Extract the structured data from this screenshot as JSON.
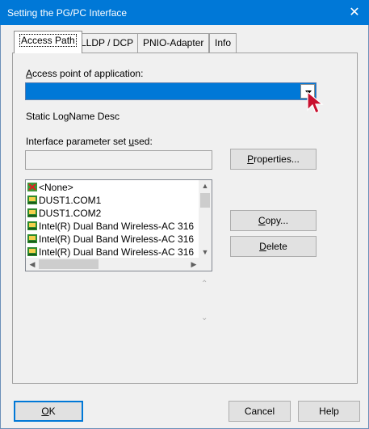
{
  "window": {
    "title": "Setting the PG/PC Interface",
    "close_glyph": "✕"
  },
  "tabs": [
    {
      "label": "Access Path",
      "active": true
    },
    {
      "label": "LLDP / DCP",
      "active": false
    },
    {
      "label": "PNIO-Adapter",
      "active": false
    },
    {
      "label": "Info",
      "active": false
    }
  ],
  "access_path": {
    "access_point_label": "Access point of application:",
    "access_point_value": "",
    "logname_desc": "Static LogName Desc",
    "param_set_label": "Interface parameter set used:",
    "param_set_value": "",
    "properties_button": "Properties...",
    "copy_button": "Copy...",
    "delete_button": "Delete",
    "interface_list": [
      {
        "icon": "none-icon",
        "label": "<None>"
      },
      {
        "icon": "network-card-icon",
        "label": "DUST1.COM1"
      },
      {
        "icon": "network-card-icon",
        "label": "DUST1.COM2"
      },
      {
        "icon": "network-card-icon",
        "label": "Intel(R) Dual Band Wireless-AC 316"
      },
      {
        "icon": "network-card-icon",
        "label": "Intel(R) Dual Band Wireless-AC 316"
      },
      {
        "icon": "network-card-icon",
        "label": "Intel(R) Dual Band Wireless-AC 316"
      }
    ]
  },
  "footer": {
    "ok_button": "OK",
    "cancel_button": "Cancel",
    "help_button": "Help"
  },
  "colors": {
    "titlebar": "#0078d7",
    "selection": "#0078d7",
    "cursor": "#c8102e"
  }
}
